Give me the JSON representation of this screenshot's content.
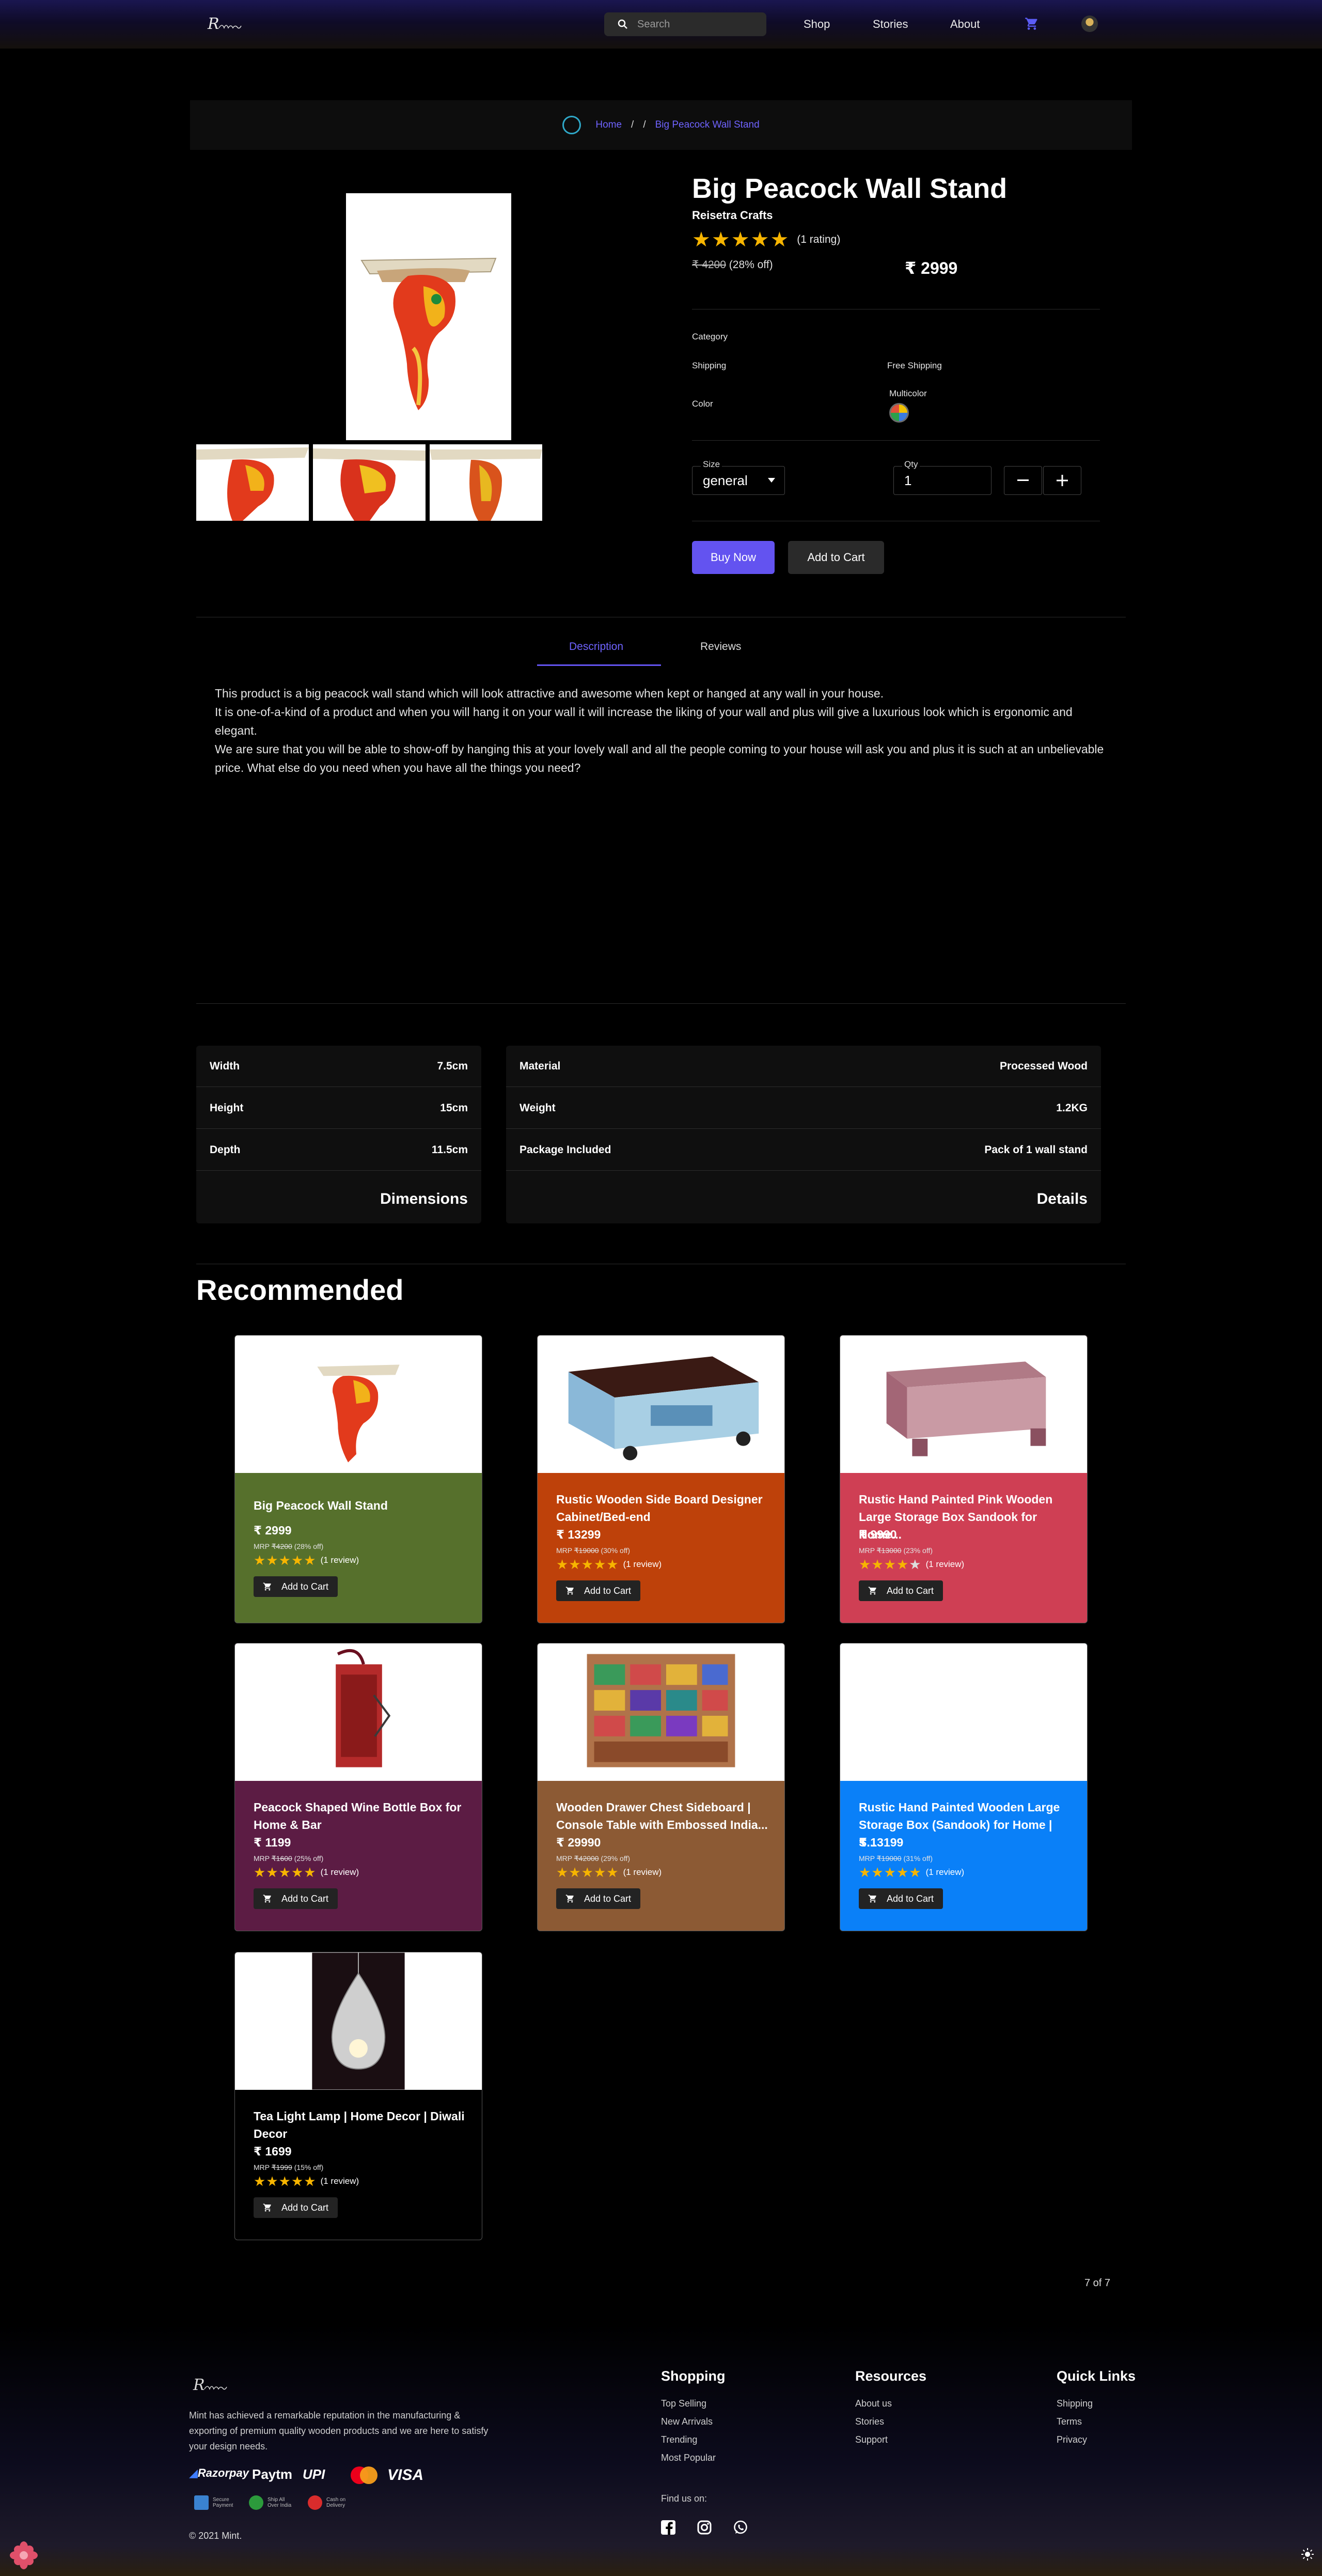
{
  "nav": {
    "logo_text": "Reisetra",
    "search_placeholder": "Search",
    "links": [
      "Shop",
      "Stories",
      "About"
    ]
  },
  "breadcrumb": {
    "home": "Home",
    "sep": "/",
    "current": "Big Peacock Wall Stand"
  },
  "product": {
    "title": "Big Peacock Wall Stand",
    "brand": "Reisetra Crafts",
    "rating_text": "(1 rating)",
    "rating": 5,
    "mrp": "₹ 4200",
    "discount": "(28% off)",
    "price": "₹ 2999",
    "category_label": "Category",
    "shipping_label": "Shipping",
    "shipping_value": "Free Shipping",
    "color_label": "Color",
    "color_value": "Multicolor",
    "size_label": "Size",
    "size_value": "general",
    "qty_label": "Qty",
    "qty_value": "1",
    "buy_now": "Buy Now",
    "add_to_cart": "Add to Cart"
  },
  "tabs": {
    "description": "Description",
    "reviews": "Reviews"
  },
  "description": [
    "This product is a big peacock wall stand which will look attractive and awesome when kept or hanged at any wall in your house.",
    "It is one-of-a-kind of a product and when you will hang it on your wall it will increase the liking of your wall and plus will give a luxurious look which is ergonomic and elegant.",
    "We are sure that you will be able to show-off by hanging this at your lovely wall and all the people coming to your house will ask you and plus it is such at an unbelievable price. What else do you need when you have all the things you need?"
  ],
  "dimensions": {
    "heading": "Dimensions",
    "rows": [
      {
        "label": "Width",
        "value": "7.5cm"
      },
      {
        "label": "Height",
        "value": "15cm"
      },
      {
        "label": "Depth",
        "value": "11.5cm"
      }
    ]
  },
  "details": {
    "heading": "Details",
    "rows": [
      {
        "label": "Material",
        "value": "Processed Wood"
      },
      {
        "label": "Weight",
        "value": "1.2KG"
      },
      {
        "label": "Package Included",
        "value": "Pack of 1 wall stand"
      }
    ]
  },
  "recommended": {
    "title": "Recommended",
    "add_to_cart": "Add to Cart",
    "mrp_prefix": "MRP",
    "items": [
      {
        "name": "Big Peacock Wall Stand",
        "price": "₹ 2999",
        "mrp": "₹4200",
        "off": "(28% off)",
        "rating": 5,
        "reviews": "(1 review)",
        "color": "#56702c"
      },
      {
        "name": "Rustic Wooden Side Board Designer Cabinet/Bed-end",
        "price": "₹ 13299",
        "mrp": "₹19000",
        "off": "(30% off)",
        "rating": 5,
        "reviews": "(1 review)",
        "color": "#be410a"
      },
      {
        "name": "Rustic Hand Painted Pink Wooden Large Storage Box Sandook for Home...",
        "price": "₹ 9990",
        "mrp": "₹13000",
        "off": "(23% off)",
        "rating": 4,
        "reviews": "(1 review)",
        "color": "#cf3f54"
      },
      {
        "name": "Peacock Shaped Wine Bottle Box for Home & Bar",
        "price": "₹ 1199",
        "mrp": "₹1600",
        "off": "(25% off)",
        "rating": 5,
        "reviews": "(1 review)",
        "color": "#5c1c44"
      },
      {
        "name": "Wooden Drawer Chest Sideboard | Console Table with Embossed India...",
        "price": "₹ 29990",
        "mrp": "₹42000",
        "off": "(29% off)",
        "rating": 5,
        "reviews": "(1 review)",
        "color": "#8c5a34"
      },
      {
        "name": "Rustic Hand Painted Wooden Large Storage Box (Sandook) for Home | S...",
        "price": "₹ 13199",
        "mrp": "₹19000",
        "off": "(31% off)",
        "rating": 5,
        "reviews": "(1 review)",
        "color": "#0a80f8"
      },
      {
        "name": "Tea Light Lamp | Home Decor | Diwali Decor",
        "price": "₹ 1699",
        "mrp": "₹1999",
        "off": "(15% off)",
        "rating": 5,
        "reviews": "(1 review)",
        "color": "#000000"
      }
    ]
  },
  "pager": "7 of 7",
  "footer": {
    "logo_text": "Reisetra",
    "about": "Mint has achieved a remarkable reputation in the manufacturing & exporting of premium quality wooden products and we are here to satisfy your design needs.",
    "payments": [
      "Razorpay",
      "Paytm",
      "UPI",
      "VISA"
    ],
    "badges": [
      "Secure Payment",
      "Ship All Over India",
      "Cash on Delivery"
    ],
    "shopping": {
      "title": "Shopping",
      "links": [
        "Top Selling",
        "New Arrivals",
        "Trending",
        "Most Popular"
      ]
    },
    "resources": {
      "title": "Resources",
      "links": [
        "About us",
        "Stories",
        "Support"
      ]
    },
    "quick": {
      "title": "Quick Links",
      "links": [
        "Shipping",
        "Terms",
        "Privacy"
      ]
    },
    "find_us": "Find us on:",
    "copyright": "© 2021 Mint."
  }
}
